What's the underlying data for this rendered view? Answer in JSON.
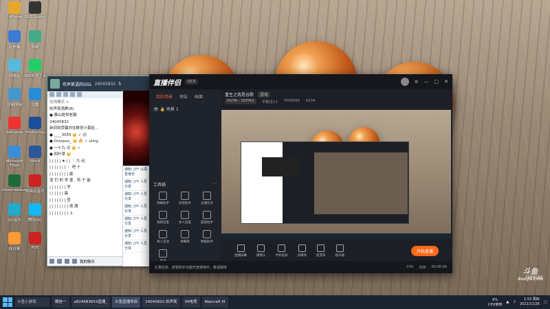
{
  "desktop": {
    "icons": [
      "CdPlayer",
      "OBS Studio",
      "此电脑",
      "网络",
      "回收站",
      "360安全卫士",
      "控制面板",
      "迅雷",
      "WeGame",
      "Photoshop",
      "Microsoft Edge",
      "Word",
      "Dreamweaver",
      "网易云音乐",
      "QQ音乐",
      "腾讯QQ",
      "向日葵",
      "PDF"
    ]
  },
  "qq": {
    "title": "欢声笑语的GGL",
    "group_id": "24045832",
    "members": "5",
    "list": [
      "在线模式 ∨",
      "欢声笑语群(8)",
      "● 泰山绝世老猿",
      "24045832",
      "新到到荧幕白往群员小黄臣...",
      "● ____3055  👑  ✓ 😊",
      "● Octopus_ 👑 🔥 ✓ uling",
      "● 一十九 😊 👑 ✓",
      "● 四叶草 👑",
      "| | | | | ★ | | ｜ 九 纪",
      "| | | | | | | ｜ 吧 十",
      "| | | | | | | | 最",
      "道 们 的 世 墨 · 鸡 于 能",
      "| | | | | | | 学",
      "| | | | | | 最",
      "| | | | | | | 查",
      "| | | | | | | | 清 满",
      "| | | | | | | | 上"
    ],
    "chat_msgs": [
      "通知: [YY 以语音身份",
      "通知: [YY 人员分享",
      "通知: [YY 人员分享",
      "通知: [YY 人员分享",
      "通知: [YY 人员分享",
      "通知: [YY 人员分享",
      "通知: [YY 人员分享"
    ],
    "bottom_label": "我的聊天"
  },
  "stream": {
    "logo": "直播伴侣",
    "version": "v5.0",
    "tabs": [
      "我的场景",
      "预告",
      "画面"
    ],
    "scene": "场景 1",
    "tools_title": "工具箱",
    "tools": [
      "弹幕助手",
      "房管助手",
      "主播任务",
      "视频连麦",
      "多人连麦",
      "超管助手",
      "真人互动",
      "弹幕库",
      "数据助手",
      "互动"
    ],
    "room_title": "重生之我是谷歌",
    "room_tag": "游戏",
    "category": "DOTA - DOTA2",
    "stats": [
      "平板位11",
      "7699565",
      "4234"
    ],
    "controls": [
      "直播屏幕",
      "摄像头",
      "手机投屏",
      "多媒体",
      "麦克风",
      "扬声器"
    ],
    "start_label": "开始直播",
    "status_left": "礼物任务、房管助手功能开放使用中，敬请期待",
    "status_right": [
      "CPU",
      "内存",
      "00:00:00"
    ]
  },
  "taskbar": {
    "search": "斗鱼小游戏",
    "buttons": [
      "微信一  ",
      "a824683653直播_",
      "",
      "斗鱼直播伴侣",
      "24045832-欢声笑",
      "",
      "09电竞",
      "",
      "Warcraft III"
    ],
    "cpu": "6%\nCPU使用",
    "time": "1:53 周四",
    "date": "2021/11/26"
  },
  "watermark": {
    "logo": "斗鱼",
    "site": "douyu.com",
    "count": "7699565"
  }
}
